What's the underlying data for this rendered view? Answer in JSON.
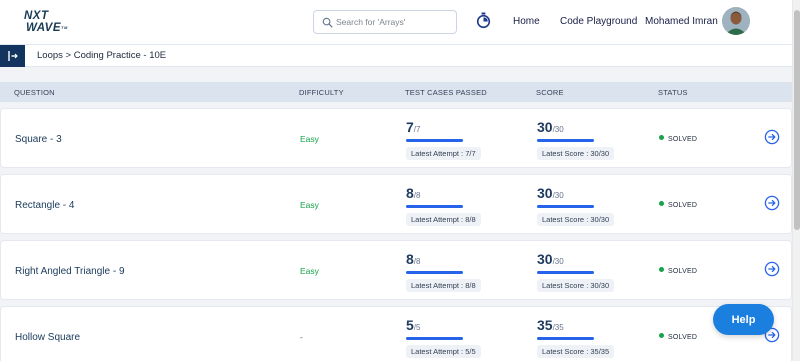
{
  "header": {
    "logo_line1": "NXT",
    "logo_line2": "WAVE",
    "logo_tm": "TM",
    "search_placeholder": "Search for 'Arrays'",
    "nav": {
      "home": "Home",
      "code_playground": "Code Playground"
    },
    "user_name": "Mohamed Imran"
  },
  "breadcrumb": {
    "text": "Loops > Coding Practice - 10E"
  },
  "table": {
    "columns": {
      "question": "QUESTION",
      "difficulty": "DIFFICULTY",
      "tests": "TEST CASES PASSED",
      "score": "SCORE",
      "status": "STATUS"
    },
    "rows": [
      {
        "question": "Square - 3",
        "difficulty": "Easy",
        "tests_passed": "7",
        "tests_total": "/7",
        "latest_attempt": "Latest Attempt : 7/7",
        "score": "30",
        "score_total": "/30",
        "latest_score": "Latest Score : 30/30",
        "status": "SOLVED"
      },
      {
        "question": "Rectangle - 4",
        "difficulty": "Easy",
        "tests_passed": "8",
        "tests_total": "/8",
        "latest_attempt": "Latest Attempt : 8/8",
        "score": "30",
        "score_total": "/30",
        "latest_score": "Latest Score : 30/30",
        "status": "SOLVED"
      },
      {
        "question": "Right Angled Triangle - 9",
        "difficulty": "Easy",
        "tests_passed": "8",
        "tests_total": "/8",
        "latest_attempt": "Latest Attempt : 8/8",
        "score": "30",
        "score_total": "/30",
        "latest_score": "Latest Score : 30/30",
        "status": "SOLVED"
      },
      {
        "question": "Hollow Square",
        "difficulty": "-",
        "tests_passed": "5",
        "tests_total": "/5",
        "latest_attempt": "Latest Attempt : 5/5",
        "score": "35",
        "score_total": "/35",
        "latest_score": "Latest Score : 35/35",
        "status": "SOLVED"
      }
    ]
  },
  "help_button": "Help",
  "colors": {
    "easy": "#16a34a",
    "accent": "#2563eb",
    "brand_dark": "#12345e",
    "help": "#1b7fe0"
  },
  "icons": {
    "search": "search-icon",
    "timer": "stopwatch-icon",
    "row_action": "arrow-right-circle-icon",
    "sidebar": "collapse-sidebar-icon"
  }
}
